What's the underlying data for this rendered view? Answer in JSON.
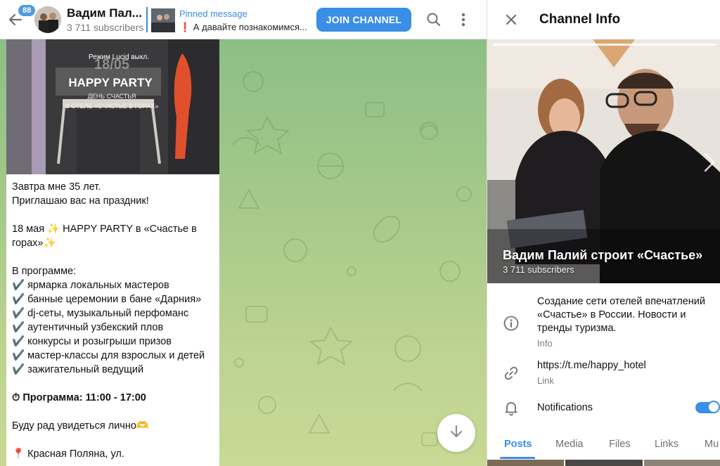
{
  "header": {
    "unread_count": "88",
    "channel_title": "Вадим Пал...",
    "subscribers": "3 711 subscribers",
    "pinned_label": "Pinned message",
    "pinned_text": "❗ А давайте познакомимся...",
    "join_label": "JOIN CHANNEL"
  },
  "message": {
    "image_overlay": {
      "mode_label": "Режим Lucid выкл.",
      "date": "18/05",
      "headline": "HAPPY PARTY",
      "line1": "ДЕНЬ СЧАСТЬЯ",
      "line2": "В ОТЕЛЕ «СЧАСТЬЕ В ГОРАХ»"
    },
    "lines": [
      "Завтра мне 35 лет.",
      "Приглашаю вас на праздник!",
      "",
      "18 мая ✨ HAPPY PARTY в «Счастье в горах»✨",
      "",
      "В программе:",
      "✔️ ярмарка локальных мастеров",
      "✔️ банные церемонии в бане «Дарния»",
      "✔️ dj-сеты, музыкальный перфоманс",
      "✔️ аутентичный узбекский плов",
      "✔️ конкурсы и розыгрыши призов",
      "✔️ мастер-классы для взрослых и детей",
      "✔️ зажигательный ведущий",
      "",
      "⏱ Программа: 11:00 - 17:00",
      "",
      "Буду рад увидеться лично🫶",
      "",
      "📍 Красная Поляна, ул."
    ]
  },
  "panel": {
    "title": "Channel Info",
    "channel_name": "Вадим Палий строит «Счастье»",
    "subscribers": "3 711 subscribers",
    "info_text": "Создание сети отелей впечатлений «Счастье» в России. Новости и тренды туризма.",
    "info_label": "Info",
    "link_text": "https://t.me/happy_hotel",
    "link_label": "Link",
    "notifications_label": "Notifications",
    "notifications_on": true,
    "tabs": [
      "Posts",
      "Media",
      "Files",
      "Links",
      "Mu"
    ]
  },
  "colors": {
    "accent": "#3a8ee6",
    "badge": "#4f9be3",
    "chat_bg_top": "#8cbf86",
    "chat_bg_bottom": "#c9d895"
  },
  "icons": [
    "back-arrow-icon",
    "search-icon",
    "more-vertical-icon",
    "close-icon",
    "info-icon",
    "link-icon",
    "bell-icon",
    "arrow-down-icon",
    "chevron-right-icon"
  ]
}
